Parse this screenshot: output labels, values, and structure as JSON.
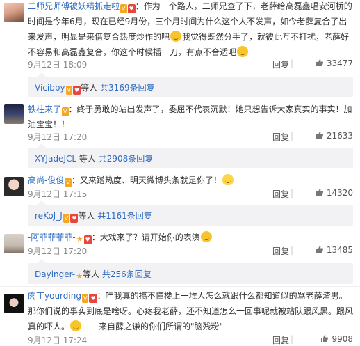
{
  "comments": [
    {
      "username": "二师兄师傅被妖精抓走啦",
      "sep": "：",
      "text_parts": [
        "作为一个路人，二师兄查了下，老薛给高磊鑫唱安河桥的时间是今年6月，现在已经9月份，三个月时间为什么这个人不发声，如今老薛复合了出来发声，明显是来借复合热度炒作的吧",
        "我觉得既然分手了，就彼此互不打扰，老薛好不容易和高磊鑫复合，你这个时候插一刀，有点不合适吧"
      ],
      "time": "9月12日 18:09",
      "reply_label": "回复",
      "likes": "33477",
      "sub": {
        "user": "Vicibby",
        "mid": "等人",
        "more": "共3169条回复"
      }
    },
    {
      "username": "铁柱来了",
      "sep": "：",
      "text_parts": [
        "终于勇敢的站出发声了，委屈不代表沉默！她只想告诉大家真实的事实！加油宝宝！！"
      ],
      "time": "9月12日 17:20",
      "reply_label": "回复",
      "likes": "21633",
      "sub": {
        "user": "XYJadeJCL",
        "mid": "等人",
        "more": "共2908条回复"
      }
    },
    {
      "username": "高尚-俊俊",
      "sep": "：",
      "text_parts": [
        "又来蹭热度、明天微博头条就是你了！"
      ],
      "time": "9月12日 17:15",
      "reply_label": "回复",
      "likes": "14320",
      "sub": {
        "user": "reKoJ_J",
        "mid": "等人",
        "more": "共1161条回复"
      }
    },
    {
      "username": "-阿菲菲菲菲-",
      "sep": "：",
      "text_parts": [
        "大戏来了？请开始你的表演"
      ],
      "time": "9月12日 17:20",
      "reply_label": "回复",
      "likes": "13485",
      "sub": {
        "user": "Dayinger-",
        "mid": "等人",
        "more": "共256条回复"
      }
    },
    {
      "username": "肉丁yourding",
      "sep": "：",
      "text_parts": [
        "哇我真的搞不懂楼上一堆人怎么就跟什么都知道似的骂老薛渣男。那你们说的事实到底是啥呀。心疼我老薛，还不知道怎么一回事呢就被站队跟风黑。跟风真的吓人。",
        "——来自薛之谦的你们所谓的\"脑残粉\""
      ],
      "time": "9月12日 17:24",
      "reply_label": "回复",
      "likes": "9908"
    }
  ],
  "colors": {
    "username": "#eb7350",
    "link": "#2e6bbf",
    "meta": "#888888",
    "subbox_bg": "#f2f2f5"
  },
  "icons": {
    "like": "thumbs-up-icon",
    "smile": "smile-emoji-icon",
    "duck": "duck-emoji-icon",
    "vip": "vip-badge-icon",
    "star": "star-badge-icon"
  }
}
